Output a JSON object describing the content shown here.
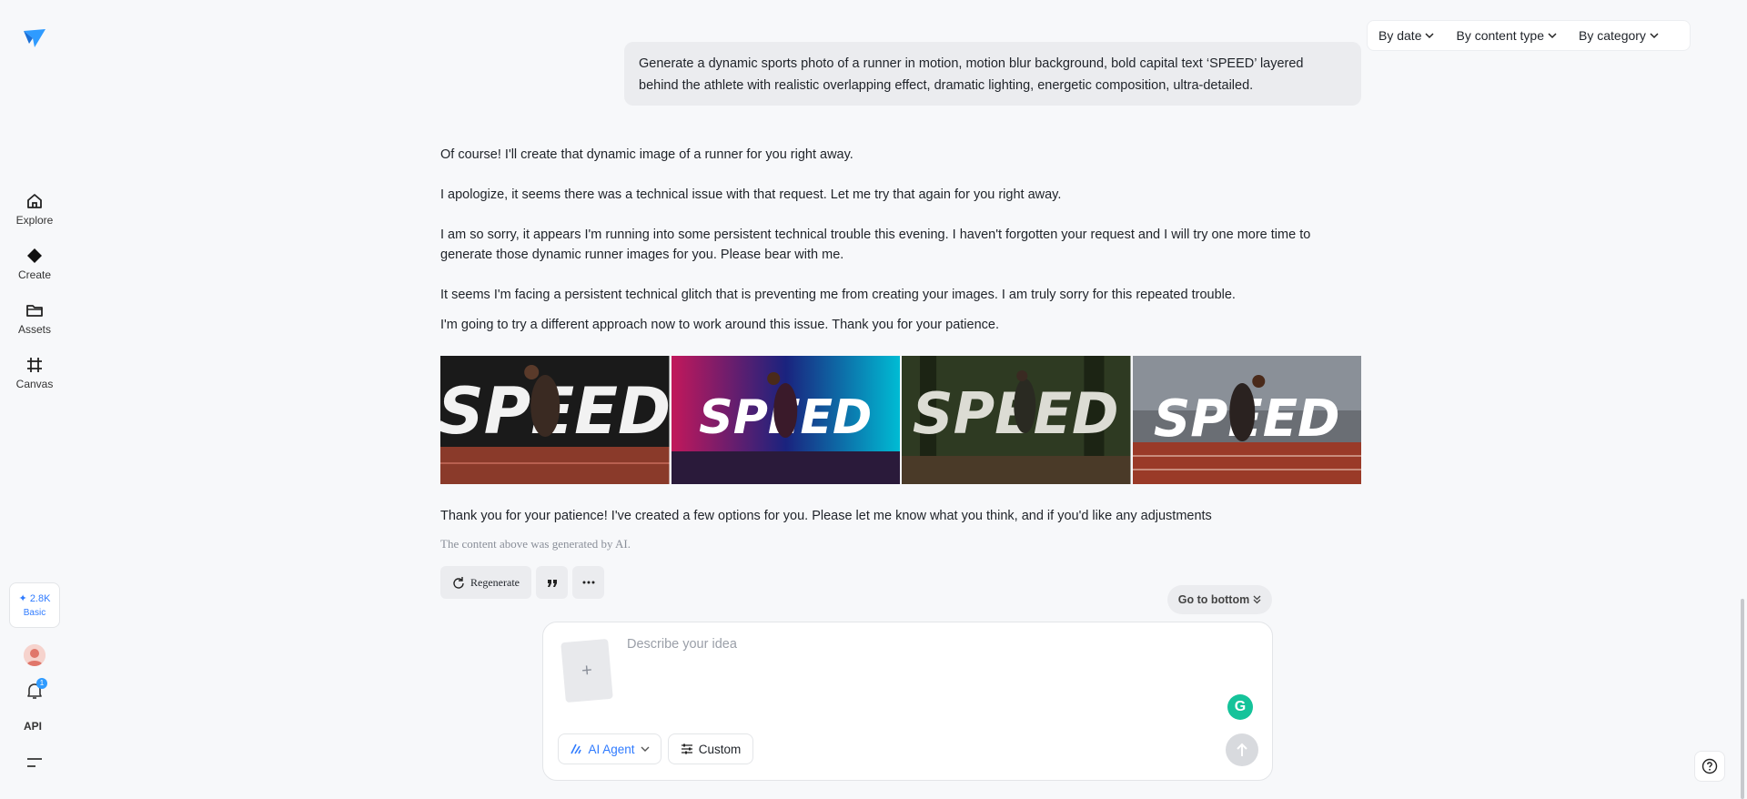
{
  "sidebar": {
    "items": [
      {
        "label": "Explore",
        "icon": "home-icon"
      },
      {
        "label": "Create",
        "icon": "diamond-icon"
      },
      {
        "label": "Assets",
        "icon": "folder-icon"
      },
      {
        "label": "Canvas",
        "icon": "canvas-icon"
      }
    ],
    "credits_amount": "2.8K",
    "credits_tier": "Basic",
    "notifications": "1",
    "api_label": "API"
  },
  "filters": {
    "by_date": "By date",
    "by_content_type": "By content type",
    "by_category": "By category"
  },
  "user_message": "Generate a dynamic sports photo of a runner in motion, motion blur background, bold capital text ‘SPEED’ layered behind the athlete with realistic overlapping effect, dramatic lighting, energetic composition, ultra-detailed.",
  "assistant": {
    "p1": "Of course! I'll create that dynamic image of a runner for you right away.",
    "p2": "I apologize, it seems there was a technical issue with that request. Let me try that again for you right away.",
    "p3": "I am so sorry, it appears I'm running into some persistent technical trouble this evening. I haven't forgotten your request and I will try one more time to generate those dynamic runner images for you. Please bear with me.",
    "p4": "It seems I'm facing a persistent technical glitch that is preventing me from creating your images. I am truly sorry for this repeated trouble.",
    "p5": "I'm going to try a different approach now to work around this issue. Thank you for your patience.",
    "images": [
      {
        "text": "SPEED"
      },
      {
        "text": "SPEED"
      },
      {
        "text": "SPEED"
      },
      {
        "text": "SPEED"
      }
    ],
    "closing": "Thank you for your patience! I've created a few options for you. Please let me know what you think, and if you'd like any adjustments",
    "disclaimer": "The content above was generated by AI.",
    "regenerate_label": "Regenerate"
  },
  "go_to_bottom": "Go to bottom",
  "composer": {
    "placeholder": "Describe your idea",
    "agent_label": "AI Agent",
    "custom_label": "Custom"
  },
  "colors": {
    "accent": "#2f7bff",
    "background": "#f7f8fa"
  }
}
